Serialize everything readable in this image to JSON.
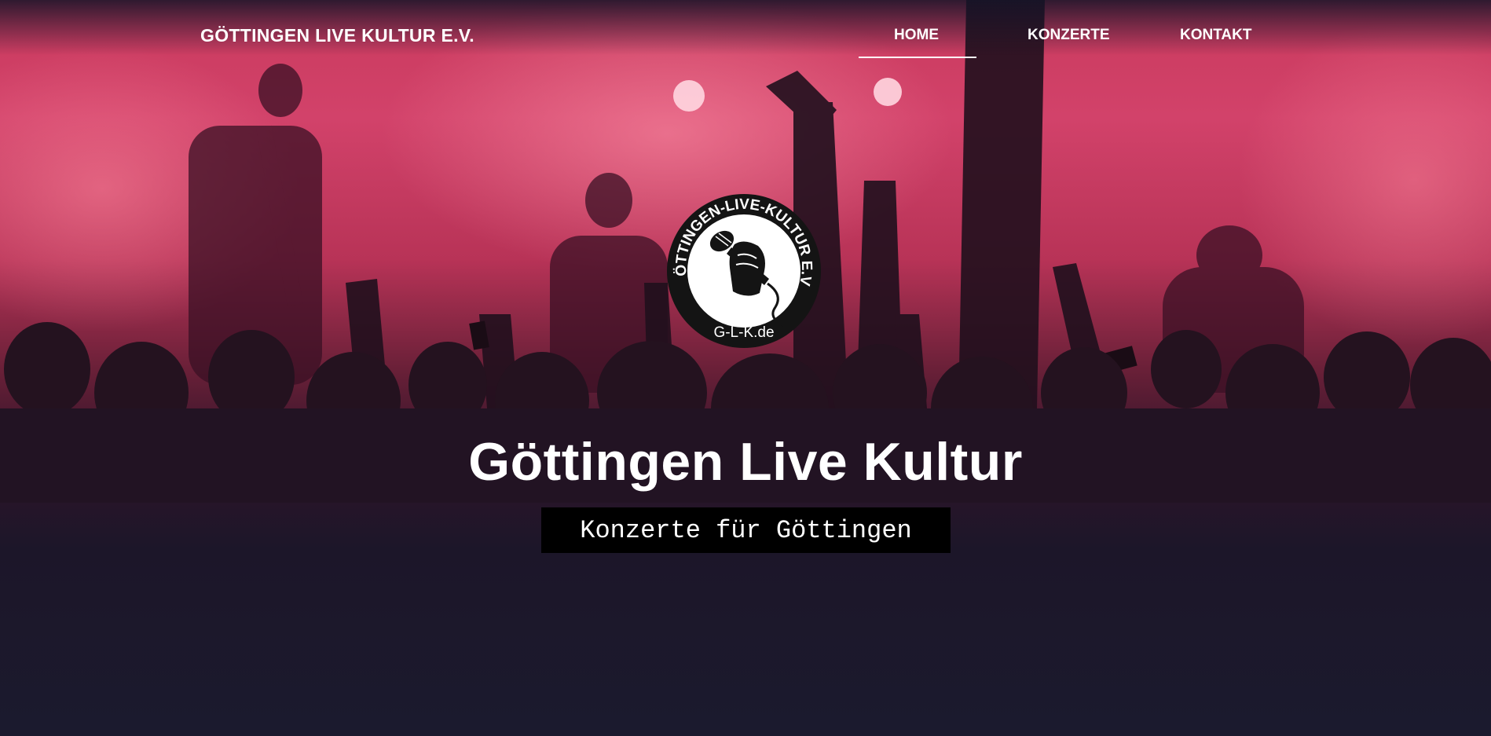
{
  "brand": {
    "name": "GÖTTINGEN LIVE KULTUR E.V."
  },
  "nav": {
    "items": [
      {
        "label": "HOME",
        "active": true
      },
      {
        "label": "KONZERTE",
        "active": false
      },
      {
        "label": "KONTAKT",
        "active": false
      }
    ]
  },
  "logo": {
    "ring_text": "GÖTTINGEN-LIVE-KULTUR E.V.",
    "bottom_text": "G-L-K.de",
    "icon": "fist-microphone-icon"
  },
  "hero": {
    "title": "Göttingen Live Kultur",
    "subtitle": "Konzerte für Göttingen"
  },
  "colors": {
    "stage_light": "#d2426a",
    "page_bottom": "#1b1a2e",
    "subtitle_background": "#000000",
    "text": "#ffffff"
  }
}
